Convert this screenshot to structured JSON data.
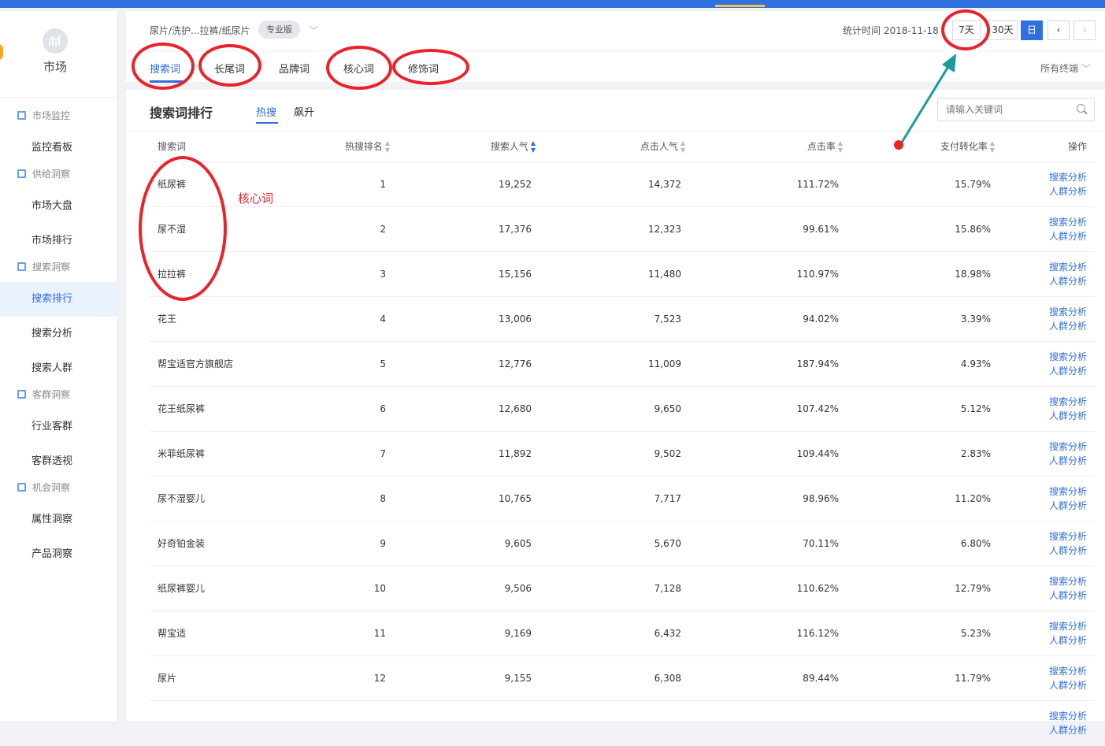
{
  "sidebar": {
    "logo_label": "市场",
    "groups": [
      {
        "label": "市场监控",
        "items": [
          "监控看板"
        ]
      },
      {
        "label": "供给洞察",
        "items": [
          "市场大盘",
          "市场排行"
        ]
      },
      {
        "label": "搜索洞察",
        "items": [
          "搜索排行",
          "搜索分析",
          "搜索人群"
        ]
      },
      {
        "label": "客群洞察",
        "items": [
          "行业客群",
          "客群透视"
        ]
      },
      {
        "label": "机会洞察",
        "items": [
          "属性洞察",
          "产品洞察"
        ]
      }
    ],
    "active_item": "搜索排行"
  },
  "header": {
    "breadcrumb": "尿片/洗护...拉裤/纸尿片",
    "edition_badge": "专业版",
    "stat_label": "统计时间",
    "stat_date": "2018-11-18",
    "range_buttons": [
      "7天",
      "30天",
      "日"
    ],
    "prev": "‹",
    "next": "›",
    "tabs": [
      "搜索词",
      "长尾词",
      "品牌词",
      "核心词",
      "修饰词"
    ],
    "terminal": "所有终端"
  },
  "panel": {
    "title": "搜索词排行",
    "subtabs": [
      "热搜",
      "飙升"
    ],
    "search_placeholder": "请输入关键词",
    "columns": [
      "搜索词",
      "热搜排名",
      "搜索人气",
      "点击人气",
      "点击率",
      "支付转化率",
      "操作"
    ],
    "op_links": [
      "搜索分析",
      "人群分析"
    ],
    "rows": [
      [
        "纸尿裤",
        "1",
        "19,252",
        "14,372",
        "111.72%",
        "15.79%"
      ],
      [
        "尿不湿",
        "2",
        "17,376",
        "12,323",
        "99.61%",
        "15.86%"
      ],
      [
        "拉拉裤",
        "3",
        "15,156",
        "11,480",
        "110.97%",
        "18.98%"
      ],
      [
        "花王",
        "4",
        "13,006",
        "7,523",
        "94.02%",
        "3.39%"
      ],
      [
        "帮宝适官方旗舰店",
        "5",
        "12,776",
        "11,009",
        "187.94%",
        "4.93%"
      ],
      [
        "花王纸尿裤",
        "6",
        "12,680",
        "9,650",
        "107.42%",
        "5.12%"
      ],
      [
        "米菲纸尿裤",
        "7",
        "11,892",
        "9,502",
        "109.44%",
        "2.83%"
      ],
      [
        "尿不湿婴儿",
        "8",
        "10,765",
        "7,717",
        "98.96%",
        "11.20%"
      ],
      [
        "好奇铂金装",
        "9",
        "9,605",
        "5,670",
        "70.11%",
        "6.80%"
      ],
      [
        "纸尿裤婴儿",
        "10",
        "9,506",
        "7,128",
        "110.62%",
        "12.79%"
      ],
      [
        "帮宝适",
        "11",
        "9,169",
        "6,432",
        "116.12%",
        "5.23%"
      ],
      [
        "尿片",
        "12",
        "9,155",
        "6,308",
        "89.44%",
        "11.79%"
      ],
      [
        "",
        "",
        "",
        "",
        "",
        ""
      ]
    ]
  },
  "annotation_text": "核心词",
  "colors": {
    "accent": "#2f6fde",
    "annotation": "#e8232c",
    "arrow": "#1a9c9a"
  }
}
